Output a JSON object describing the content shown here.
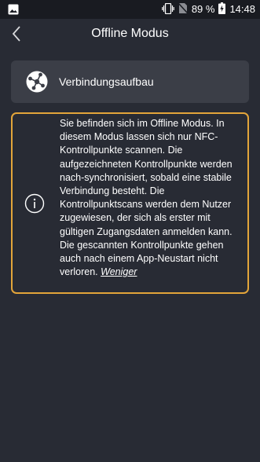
{
  "status_bar": {
    "battery_percent": "89 %",
    "time": "14:48",
    "icons": [
      "image-icon",
      "vibrate-icon",
      "no-sim-icon",
      "battery-charging-icon"
    ]
  },
  "app_bar": {
    "title": "Offline Modus",
    "back_icon": "chevron-left-icon"
  },
  "connection_card": {
    "label": "Verbindungsaufbau",
    "icon": "network-globe-icon"
  },
  "info_box": {
    "icon": "info-icon",
    "text": "Sie befinden sich im Offline Modus. In diesem Modus lassen sich nur NFC-Kontrollpunkte scannen. Die aufgezeichneten Kontrollpunkte werden nach-synchronisiert, sobald eine stabile Verbindung besteht. Die Kontrollpunktscans werden dem Nutzer zugewiesen, der sich als erster mit gültigen Zugangsdaten anmelden kann. Die gescannten Kontrollpunkte gehen auch nach einem App-Neustart nicht verloren.",
    "less_link": "Weniger",
    "border_color": "#e3a53a"
  },
  "colors": {
    "background": "#282b34",
    "card": "#3b3e47",
    "accent": "#e3a53a"
  }
}
